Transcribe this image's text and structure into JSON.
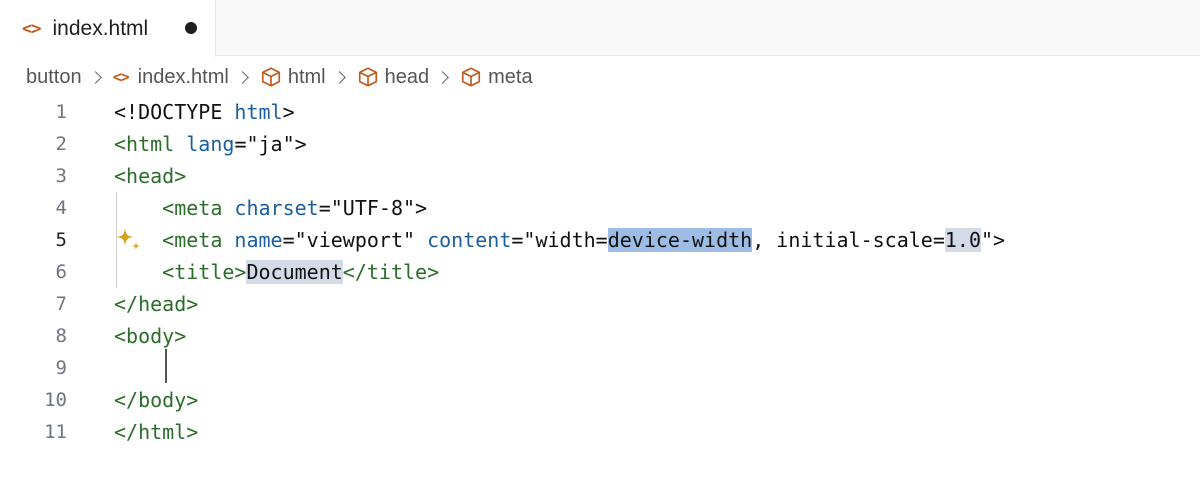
{
  "tab": {
    "icon": "<>",
    "label": "index.html",
    "dirty": true
  },
  "breadcrumb": {
    "items": [
      {
        "label": "button",
        "icon": "none"
      },
      {
        "label": "index.html",
        "icon": "code-brackets-icon",
        "glyph": "<>"
      },
      {
        "label": "html",
        "icon": "cube-icon"
      },
      {
        "label": "head",
        "icon": "cube-icon"
      },
      {
        "label": "meta",
        "icon": "cube-icon"
      }
    ]
  },
  "editor": {
    "active_line": 5,
    "line_numbers": [
      "1",
      "2",
      "3",
      "4",
      "5",
      "6",
      "7",
      "8",
      "9",
      "10",
      "11"
    ],
    "lines": {
      "l1": {
        "a": "<!DOCTYPE",
        "b": " html",
        "c": ">"
      },
      "l2": {
        "a": "<html",
        "b": " lang",
        "c": "=\"ja\">"
      },
      "l3": {
        "a": "<head>"
      },
      "l4": {
        "a": "    <meta",
        "b": " charset",
        "c": "=\"UTF-8\">"
      },
      "l5": {
        "a": "    <meta",
        "b": " name",
        "c": "=\"viewport\"",
        "d": " content",
        "e": "=\"width=",
        "f": "device-width",
        "g": ", initial-scale=",
        "h": "1.0",
        "i": "\">"
      },
      "l6": {
        "a": "    <title>",
        "b": "Document",
        "c": "</title>"
      },
      "l7": {
        "a": "</head>"
      },
      "l8": {
        "a": "<body>"
      },
      "l9": {
        "a": ""
      },
      "l10": {
        "a": "</body>"
      },
      "l11": {
        "a": "</html>"
      }
    }
  },
  "colors": {
    "tag": "#2a6e2a",
    "attribute": "#1b5fa0",
    "selection": "#9ebde6",
    "file_icon": "#c05a1a",
    "sparkle": "#d4a21a"
  }
}
